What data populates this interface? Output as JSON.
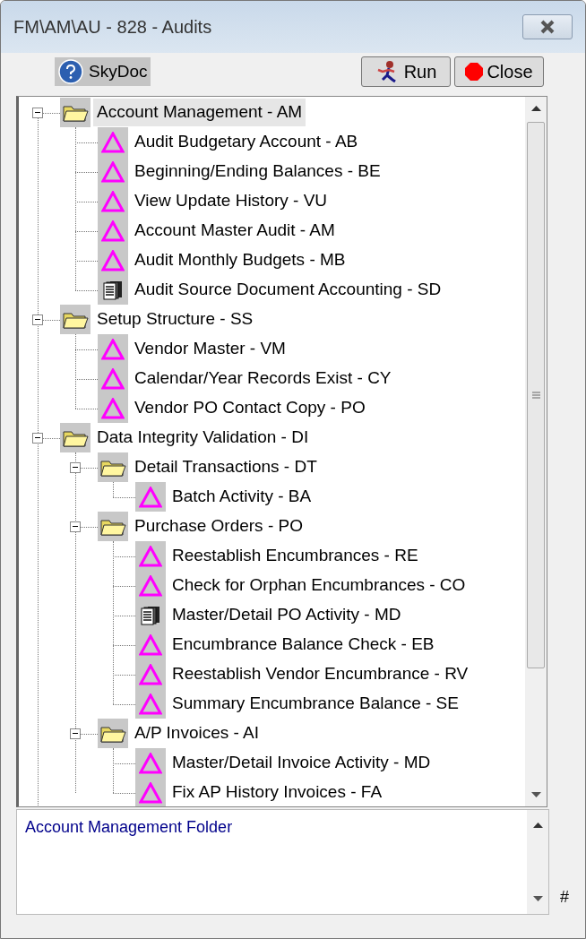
{
  "window": {
    "title": "FM\\AM\\AU - 828 - Audits"
  },
  "toolbar": {
    "help_button": "SkyDoc",
    "run_button": "Run",
    "close_button": "Close"
  },
  "tree": [
    {
      "kind": "folder",
      "label": "Account Management - AM",
      "expanded": true,
      "selected": true,
      "children": [
        {
          "kind": "audit",
          "label": "Audit Budgetary Account - AB",
          "selected": false
        },
        {
          "kind": "audit",
          "label": "Beginning/Ending Balances - BE",
          "selected": false
        },
        {
          "kind": "audit",
          "label": "View Update History - VU",
          "selected": false
        },
        {
          "kind": "audit",
          "label": "Account Master Audit - AM",
          "selected": false
        },
        {
          "kind": "audit",
          "label": "Audit Monthly Budgets - MB",
          "selected": false
        },
        {
          "kind": "document",
          "label": "Audit Source Document Accounting - SD",
          "selected": false
        }
      ]
    },
    {
      "kind": "folder",
      "label": "Setup Structure - SS",
      "expanded": true,
      "selected": false,
      "children": [
        {
          "kind": "audit",
          "label": "Vendor Master - VM",
          "selected": false
        },
        {
          "kind": "audit",
          "label": "Calendar/Year Records Exist - CY",
          "selected": false
        },
        {
          "kind": "audit",
          "label": "Vendor PO Contact Copy - PO",
          "selected": false
        }
      ]
    },
    {
      "kind": "folder",
      "label": "Data Integrity Validation - DI",
      "expanded": true,
      "selected": false,
      "children": [
        {
          "kind": "folder",
          "label": "Detail Transactions - DT",
          "expanded": true,
          "selected": false,
          "children": [
            {
              "kind": "audit",
              "label": "Batch Activity - BA",
              "selected": false
            }
          ]
        },
        {
          "kind": "folder",
          "label": "Purchase Orders - PO",
          "expanded": true,
          "selected": false,
          "children": [
            {
              "kind": "audit",
              "label": "Reestablish Encumbrances - RE",
              "selected": false
            },
            {
              "kind": "audit",
              "label": "Check for Orphan Encumbrances - CO",
              "selected": false
            },
            {
              "kind": "document",
              "label": "Master/Detail PO Activity - MD",
              "selected": false
            },
            {
              "kind": "audit",
              "label": "Encumbrance Balance Check - EB",
              "selected": false
            },
            {
              "kind": "audit",
              "label": "Reestablish Vendor Encumbrance - RV",
              "selected": false
            },
            {
              "kind": "audit",
              "label": "Summary Encumbrance Balance - SE",
              "selected": false
            }
          ]
        },
        {
          "kind": "folder",
          "label": "A/P Invoices - AI",
          "expanded": true,
          "selected": false,
          "children": [
            {
              "kind": "audit",
              "label": "Master/Detail Invoice Activity - MD",
              "selected": false
            },
            {
              "kind": "audit",
              "label": "Fix AP History Invoices - FA",
              "selected": false
            }
          ]
        }
      ]
    }
  ],
  "description": {
    "text": "Account Management Folder"
  },
  "side_mark": "#"
}
